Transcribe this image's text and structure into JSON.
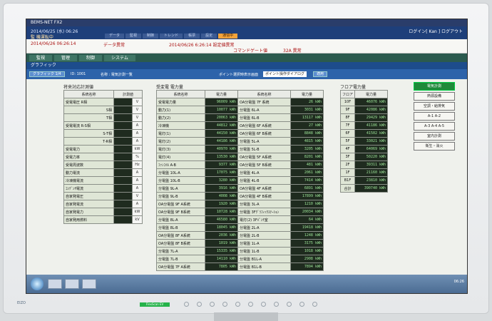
{
  "window": {
    "title": "BEMS-NET FX2",
    "datetime_line": "2014/06/25 (水) 06:26",
    "user_line": "監 機運転中"
  },
  "nav_tabs": [
    "データ",
    "監視",
    "制御",
    "トレンド",
    "帳票",
    "設定",
    "通信中"
  ],
  "logout_label": "ログイン[ Kan ] ログアウト",
  "alarms": {
    "a1": "2014/06/26 06:26:14",
    "a2": "データ異常",
    "a3": "2014/06/26 6:26:14  設定値異常",
    "a4": "コマンドゲート値",
    "a5": "32A  異常"
  },
  "menu": [
    "監視",
    "管理",
    "制御",
    "システム"
  ],
  "page_title": "グラフィック",
  "toolbar": {
    "left_btn": "グラフィック 1/4",
    "id_label": "ID: 1001",
    "name_label": "名称 : 電気計測一覧",
    "point_label": "ポイント選択時表示画面",
    "point_select": "ポイント操作ダイアログ",
    "apply_btn": "適用"
  },
  "panel1": {
    "title": "将来対応計測値",
    "headers": [
      "系統名称",
      "計測値"
    ],
    "rows": [
      [
        "受電電圧 R相",
        "V"
      ],
      [
        "S相",
        "V"
      ],
      [
        "T相",
        "V"
      ],
      [
        "受電電流 R-S相",
        "A"
      ],
      [
        "S-T相",
        "A"
      ],
      [
        "T-R相",
        "A"
      ],
      [
        "受電電力",
        "kW"
      ],
      [
        "受電力率",
        "%"
      ],
      [
        "受電周波数",
        "Hz"
      ],
      [
        "動力電流",
        "A"
      ],
      [
        "冷凍機電流",
        "A"
      ],
      [
        "ｺﾝﾃﾞﾝｻ電流",
        "A"
      ],
      [
        "自家発電圧",
        "V"
      ],
      [
        "自家発電流",
        "A"
      ],
      [
        "自家発電力",
        "kW"
      ],
      [
        "自家発用燃料",
        "kV"
      ]
    ]
  },
  "panel2": {
    "title": "受変電 電力量",
    "headers": [
      "系統名称",
      "電力量",
      "系統名称",
      "電力量"
    ],
    "rows": [
      [
        "受電電力量",
        "96009",
        "OA分電盤 7F 系統",
        "26"
      ],
      [
        "動力(1)",
        "10077",
        "分電盤 6L-A",
        "3031"
      ],
      [
        "動力(2)",
        "20063",
        "分電盤 6L-B",
        "13117"
      ],
      [
        "冷凍機",
        "44812",
        "OA分電盤 6F A系統",
        "27"
      ],
      [
        "電灯(1)",
        "44150",
        "OA分電盤 6F B系統",
        "8848"
      ],
      [
        "電灯(2)",
        "44186",
        "分電盤 5L-A",
        "4815"
      ],
      [
        "電灯(3)",
        "40970",
        "分電盤 5L-B",
        "3205"
      ],
      [
        "電灯(4)",
        "13530",
        "OA分電盤 5F A系統",
        "8201"
      ],
      [
        "ﾌｧﾝｺｲﾙ A-B",
        "9377",
        "OA分電盤 5F B系統",
        "481"
      ],
      [
        "分電盤 10L-A",
        "17075",
        "分電盤 4L-A",
        "2061"
      ],
      [
        "分電盤 10L-B",
        "3280",
        "分電盤 4L-B",
        "7414"
      ],
      [
        "分電盤 9L-A",
        "3916",
        "OA分電盤 4F A系統",
        "6891"
      ],
      [
        "分電盤 9L-B",
        "4008",
        "OA分電盤 4F B系統",
        "17899"
      ],
      [
        "OA分電盤 9F A系統",
        "1920",
        "分電盤 3L-A",
        "1210"
      ],
      [
        "OA分電盤 9F B系統",
        "10728",
        "分電盤 3Fｸﾞﾗﾌｨｯｸｽﾃｰｼｮﾝ",
        "20034"
      ],
      [
        "分電盤 8L-A",
        "46580",
        "電灯(2) 3Fﾊﾟﾝﾁ室",
        "64"
      ],
      [
        "分電盤 8L-B",
        "18045",
        "分電盤 2L-A",
        "19418"
      ],
      [
        "OA分電盤 8F A系統",
        "2036",
        "分電盤 2L-B",
        "1248"
      ],
      [
        "OA分電盤 8F B系統",
        "1019",
        "分電盤 1L-A",
        "3175"
      ],
      [
        "分電盤 7L-A",
        "15335",
        "分電盤 1L-B",
        "1018"
      ],
      [
        "分電盤 7L-B",
        "14110",
        "分電盤 B1L-A",
        "2908"
      ],
      [
        "OA分電盤 7F A系統",
        "7805",
        "分電盤 B1L-B",
        "7894"
      ]
    ]
  },
  "panel3": {
    "title": "フロア電力量",
    "headers": [
      "フロア",
      "電力量"
    ],
    "rows": [
      [
        "10F",
        "46076"
      ],
      [
        "9F",
        "42086"
      ],
      [
        "8F",
        "29429"
      ],
      [
        "7F",
        "41186"
      ],
      [
        "6F",
        "41502"
      ],
      [
        "5F",
        "33021"
      ],
      [
        "4F",
        "64069"
      ],
      [
        "3F",
        "50220"
      ],
      [
        "2F",
        "39311"
      ],
      [
        "1F",
        "21160"
      ],
      [
        "B1F",
        "23810"
      ]
    ],
    "total_label": "合計",
    "total_value": "390740",
    "unit": "kWh"
  },
  "side_buttons": [
    "電気計測",
    "熱源設備",
    "空調・給排気",
    "A-1 A-2",
    "A-3 A-4 A-5",
    "室内計測",
    "衛生・消火"
  ],
  "taskbar": {
    "clock": "06:26"
  },
  "bezel": {
    "brand": "EIZO",
    "led_label": "FlexScan EV"
  }
}
